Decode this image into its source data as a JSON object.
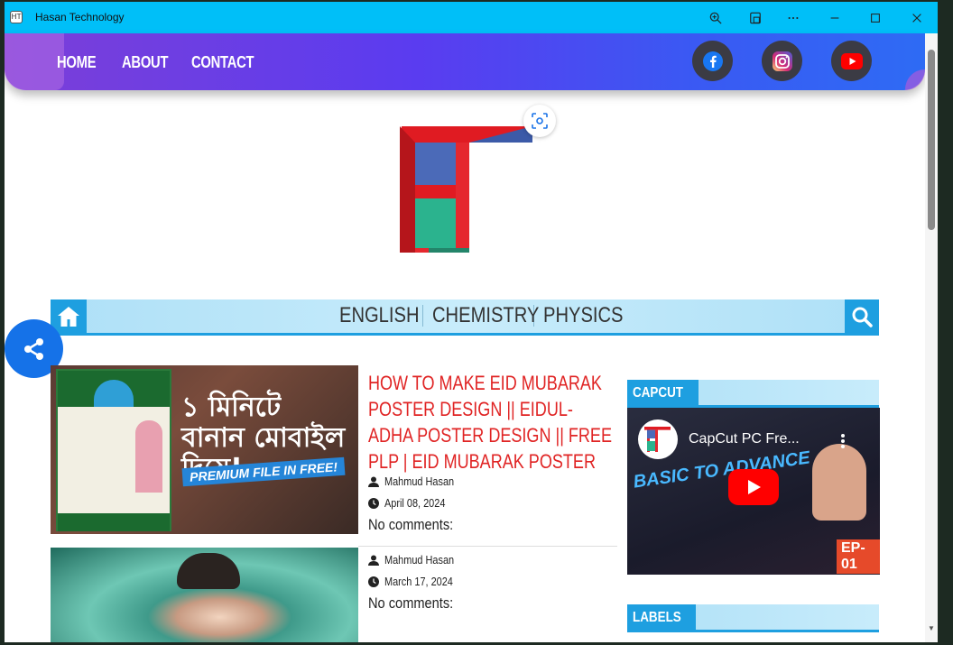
{
  "window": {
    "title": "Hasan Technology",
    "app_icon_text": "HT"
  },
  "navbar": {
    "links": [
      "HOME",
      "ABOUT",
      "CONTACT"
    ],
    "social": [
      "facebook",
      "instagram",
      "youtube"
    ]
  },
  "categories": [
    "ENGLISH",
    "CHEMISTRY",
    "PHYSICS"
  ],
  "posts": [
    {
      "title": "HOW TO MAKE EID MUBARAK POSTER DESIGN || EIDUL-ADHA POSTER DESIGN || FREE PLP | EID MUBARAK POSTER",
      "author": "Mahmud Hasan",
      "date": "April 08, 2024",
      "comments": "No comments:",
      "thumb_banner": "PREMIUM FILE IN FREE!"
    },
    {
      "title": "",
      "author": "Mahmud Hasan",
      "date": "March 17, 2024",
      "comments": "No comments:"
    }
  ],
  "sidebar": {
    "capcut_heading": "CAPCUT",
    "video_title": "CapCut PC Fre...",
    "video_overlay": "BASIC TO ADVANCE",
    "video_ep": "EP-01",
    "labels_heading": "LABELS"
  },
  "colors": {
    "titlebar": "#00bff8",
    "accent": "#1e9fe0",
    "post_title": "#e02424",
    "share": "#1572e8"
  }
}
